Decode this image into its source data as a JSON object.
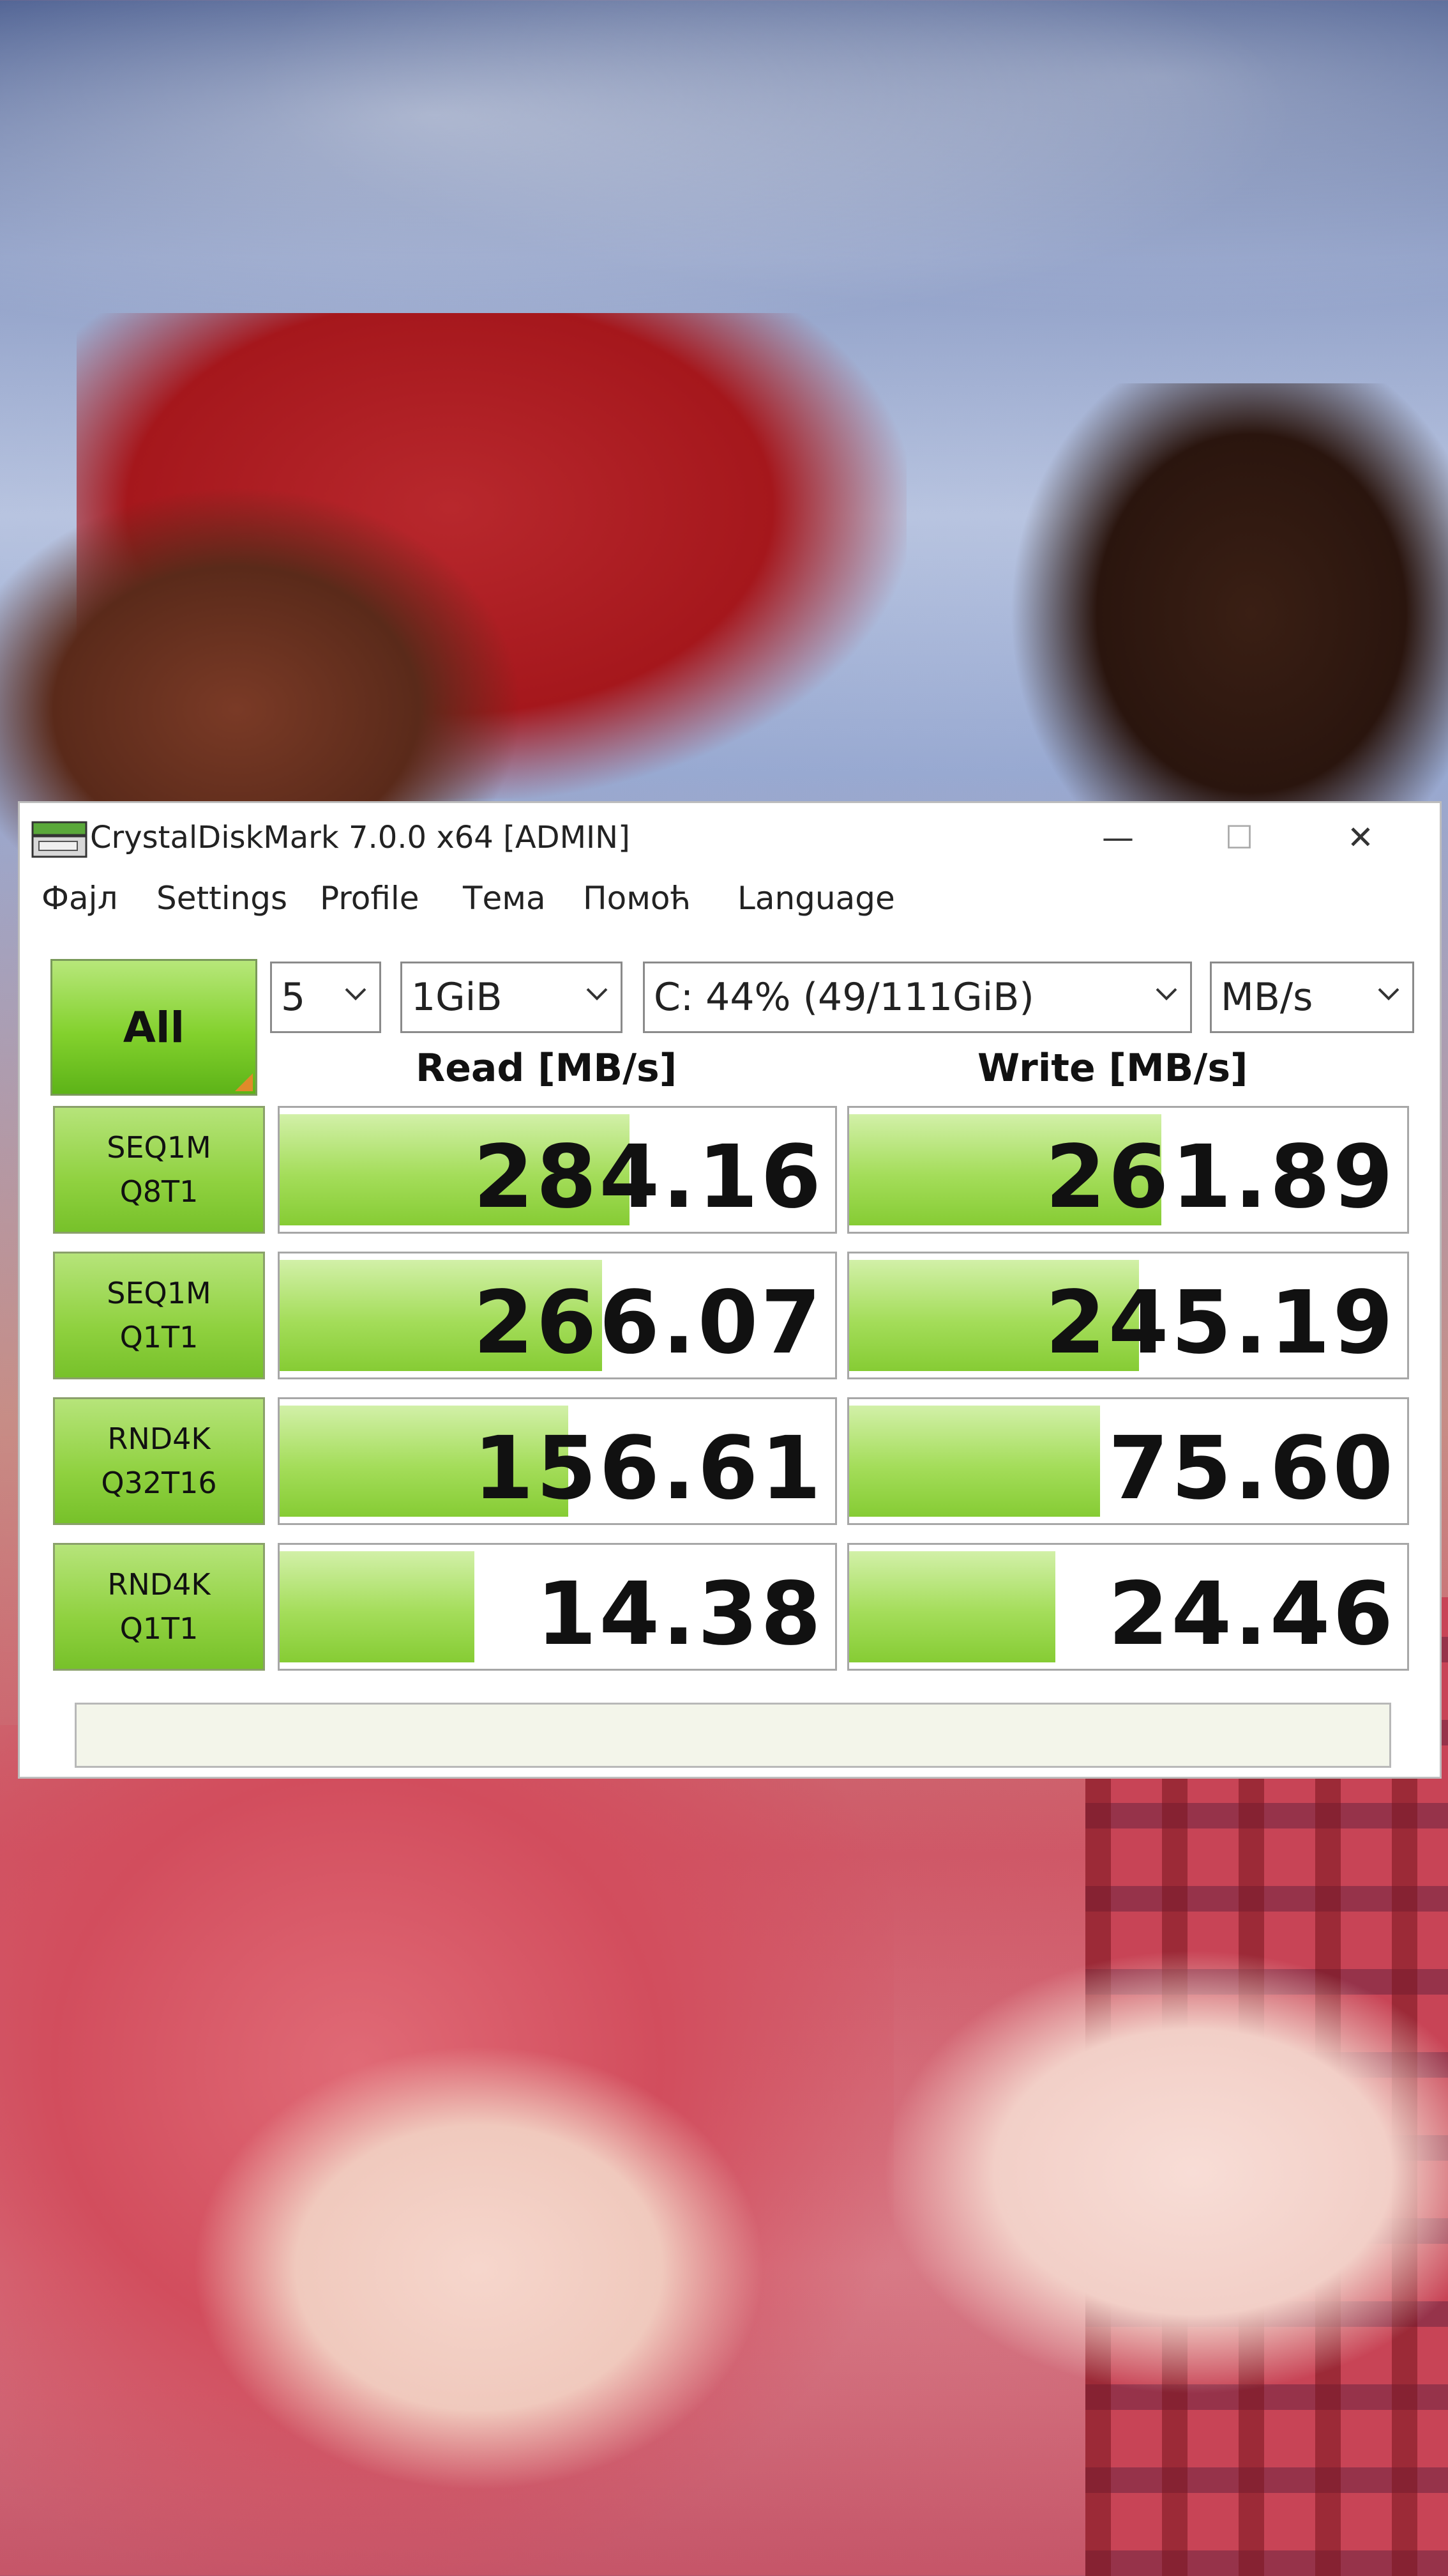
{
  "window": {
    "title": "CrystalDiskMark 7.0.0 x64 [ADMIN]",
    "controls": {
      "minimize": "—",
      "maximize": "☐",
      "close": "✕"
    }
  },
  "menu": [
    "Фајл",
    "Settings",
    "Profile",
    "Тема",
    "Помоћ",
    "Language"
  ],
  "toolbar": {
    "all_label": "All",
    "test_count": "5",
    "test_size": "1GiB",
    "drive": "C: 44% (49/111GiB)",
    "unit": "MB/s"
  },
  "headers": {
    "read": "Read [MB/s]",
    "write": "Write [MB/s]"
  },
  "rows": [
    {
      "label1": "SEQ1M",
      "label2": "Q8T1",
      "read": "284.16",
      "write": "261.89",
      "read_frac": 0.63,
      "write_frac": 0.56
    },
    {
      "label1": "SEQ1M",
      "label2": "Q1T1",
      "read": "266.07",
      "write": "245.19",
      "read_frac": 0.58,
      "write_frac": 0.52
    },
    {
      "label1": "RND4K",
      "label2": "Q32T16",
      "read": "156.61",
      "write": "75.60",
      "read_frac": 0.52,
      "write_frac": 0.45
    },
    {
      "label1": "RND4K",
      "label2": "Q1T1",
      "read": "14.38",
      "write": "24.46",
      "read_frac": 0.35,
      "write_frac": 0.37
    }
  ],
  "colors": {
    "accent_green": "#83d12d",
    "bar_green": "#a4dd5a"
  }
}
